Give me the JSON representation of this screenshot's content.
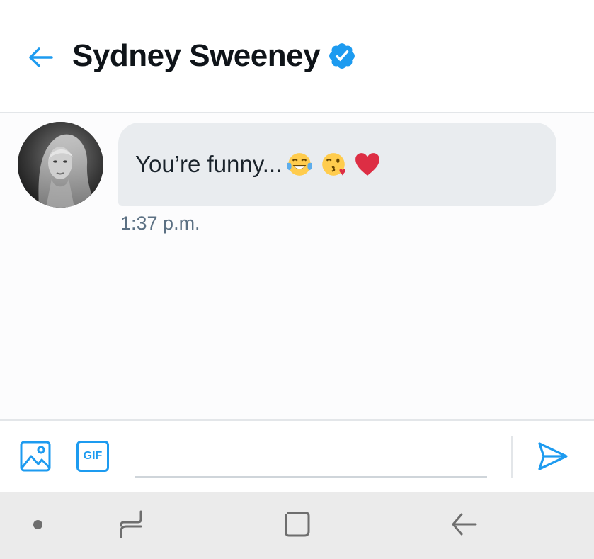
{
  "header": {
    "title": "Sydney Sweeney",
    "back_icon": "arrow-left-icon",
    "verified_icon": "verified-badge-icon"
  },
  "conversation": {
    "messages": [
      {
        "text": "You’re funny...",
        "emojis": [
          "😂",
          "😘",
          "❤"
        ],
        "timestamp": "1:37 p.m."
      }
    ]
  },
  "composer": {
    "media_icon": "image-icon",
    "gif_label": "GIF",
    "input_value": "",
    "send_icon": "send-icon"
  },
  "navbar": {
    "buttons": [
      "dot-icon",
      "recent-apps-icon",
      "home-icon",
      "back-icon"
    ]
  },
  "colors": {
    "accent": "#1d9bf0",
    "bubble": "#e9ecef",
    "title": "#0f1419",
    "timestamp": "#5b7083",
    "navbar": "#ebebeb"
  }
}
